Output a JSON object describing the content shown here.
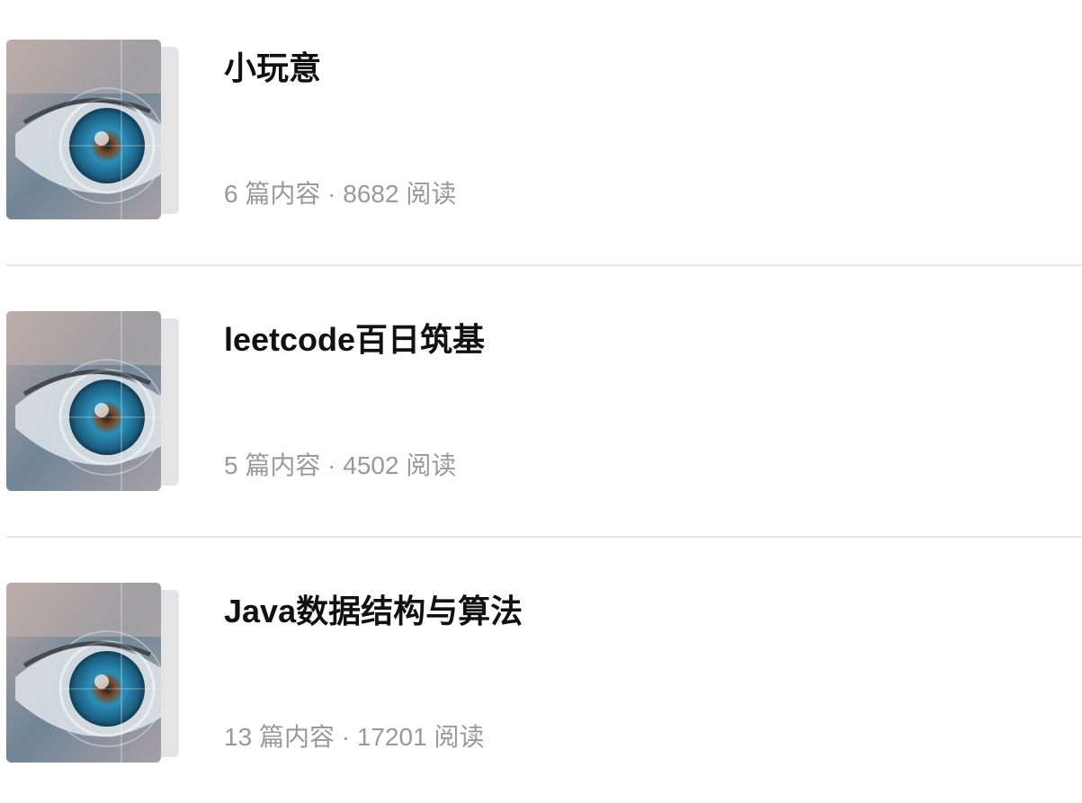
{
  "collections": [
    {
      "title": "小玩意",
      "count": "6",
      "count_unit": "篇内容",
      "separator": "·",
      "reads": "8682",
      "reads_unit": "阅读",
      "cover_icon": "eye-cover-image"
    },
    {
      "title": "leetcode百日筑基",
      "count": "5",
      "count_unit": "篇内容",
      "separator": "·",
      "reads": "4502",
      "reads_unit": "阅读",
      "cover_icon": "eye-cover-image"
    },
    {
      "title": "Java数据结构与算法",
      "count": "13",
      "count_unit": "篇内容",
      "separator": "·",
      "reads": "17201",
      "reads_unit": "阅读",
      "cover_icon": "eye-cover-image"
    }
  ],
  "colors": {
    "title": "#111111",
    "meta": "#999999",
    "divider": "#e8e8e8",
    "iris": "#2a8fb8"
  }
}
